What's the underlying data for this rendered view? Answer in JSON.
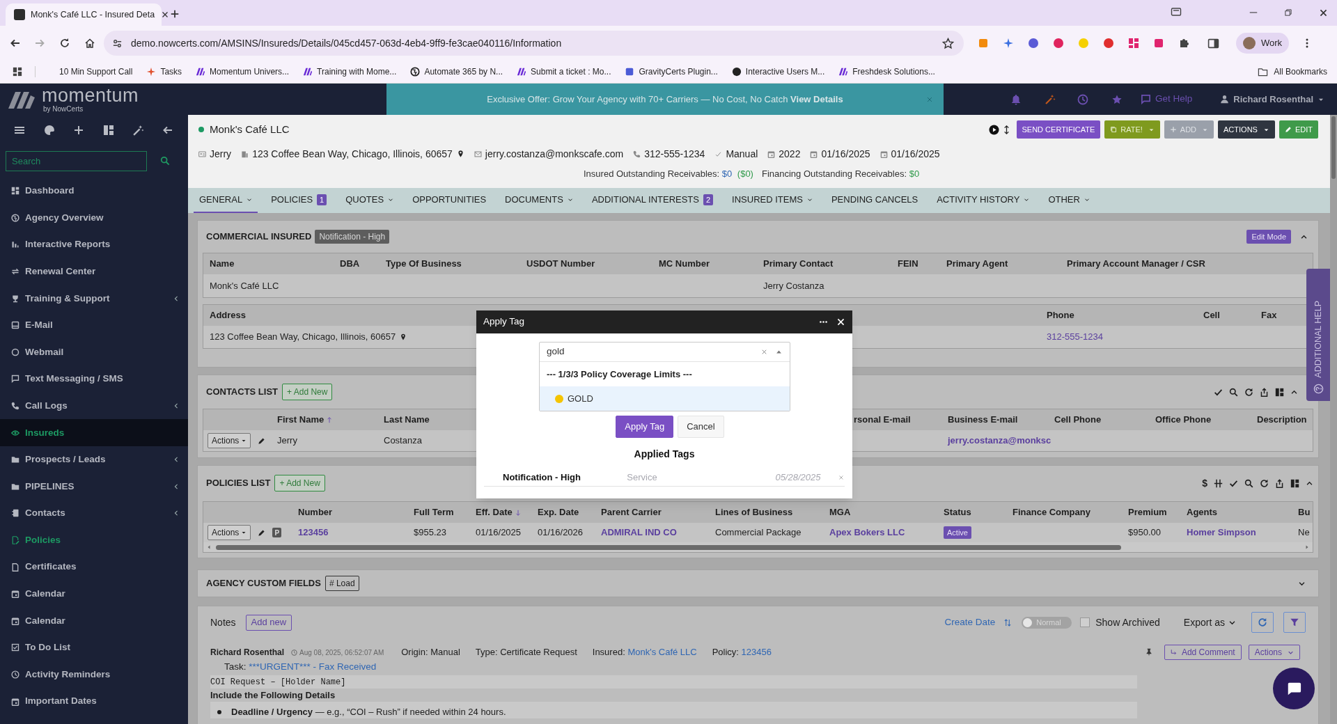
{
  "browser": {
    "tab_title": "Monk's Café LLC - Insured Deta",
    "url": "demo.nowcerts.com/AMSINS/Insureds/Details/045cd457-063d-4eb4-9ff9-fe3cae040116/Information",
    "profile": "Work",
    "bookmarks_folder": "All Bookmarks",
    "bookmarks": [
      {
        "label": "10 Min Support Call"
      },
      {
        "label": "Tasks"
      },
      {
        "label": "Momentum Univers..."
      },
      {
        "label": "Training with Mome..."
      },
      {
        "label": "Automate 365 by N..."
      },
      {
        "label": "Submit a ticket : Mo..."
      },
      {
        "label": "GravityCerts Plugin..."
      },
      {
        "label": "Interactive Users M..."
      },
      {
        "label": "Freshdesk Solutions..."
      }
    ]
  },
  "sidebar": {
    "brand": "momentum",
    "brand_sub": "by NowCerts",
    "search_placeholder": "Search",
    "items": [
      {
        "label": "Dashboard",
        "selected": false,
        "highlighted": false,
        "expandable": false
      },
      {
        "label": "Agency Overview",
        "selected": false,
        "highlighted": false,
        "expandable": false
      },
      {
        "label": "Interactive Reports",
        "selected": false,
        "highlighted": false,
        "expandable": false
      },
      {
        "label": "Renewal Center",
        "selected": false,
        "highlighted": false,
        "expandable": false
      },
      {
        "label": "Training & Support",
        "selected": false,
        "highlighted": false,
        "expandable": true
      },
      {
        "label": "E-Mail",
        "selected": false,
        "highlighted": false,
        "expandable": false
      },
      {
        "label": "Webmail",
        "selected": false,
        "highlighted": false,
        "expandable": false
      },
      {
        "label": "Text Messaging / SMS",
        "selected": false,
        "highlighted": false,
        "expandable": false
      },
      {
        "label": "Call Logs",
        "selected": false,
        "highlighted": false,
        "expandable": true
      },
      {
        "label": "Insureds",
        "selected": true,
        "highlighted": true,
        "expandable": false
      },
      {
        "label": "Prospects / Leads",
        "selected": false,
        "highlighted": false,
        "expandable": true
      },
      {
        "label": "PIPELINES",
        "selected": false,
        "highlighted": false,
        "expandable": true
      },
      {
        "label": "Contacts",
        "selected": false,
        "highlighted": false,
        "expandable": true
      },
      {
        "label": "Policies",
        "selected": false,
        "highlighted": true,
        "expandable": false
      },
      {
        "label": "Certificates",
        "selected": false,
        "highlighted": false,
        "expandable": false
      },
      {
        "label": "Calendar",
        "selected": false,
        "highlighted": false,
        "expandable": false
      },
      {
        "label": "Calendar",
        "selected": false,
        "highlighted": false,
        "expandable": false
      },
      {
        "label": "To Do List",
        "selected": false,
        "highlighted": false,
        "expandable": false
      },
      {
        "label": "Activity Reminders",
        "selected": false,
        "highlighted": false,
        "expandable": false
      },
      {
        "label": "Important Dates",
        "selected": false,
        "highlighted": false,
        "expandable": false
      }
    ]
  },
  "topbar": {
    "offer": "Exclusive Offer: Grow Your Agency with 70+ Carriers — No Cost, No Catch **View Details**",
    "help": "Get Help",
    "user": "Richard Rosenthal"
  },
  "insured": {
    "name": "Monk's Café LLC",
    "active": true,
    "actions": [
      {
        "label": "SEND CERTIFICATE",
        "kind": "send"
      },
      {
        "label": "RATE!",
        "kind": "rate"
      },
      {
        "label": "ADD",
        "kind": "add"
      },
      {
        "label": "ACTIONS",
        "kind": "actions"
      },
      {
        "label": "EDIT",
        "kind": "edit"
      }
    ],
    "info": [
      "Jerry",
      "123 Coffee Bean Way, Chicago, Illinois, 60657",
      "jerry.costanza@monkscafe.com",
      "312-555-1234",
      "Manual",
      "2022",
      "01/16/2025",
      "01/16/2025"
    ],
    "insured_receivables": {
      "label": "Insured Outstanding Receivables:",
      "amount": "$0",
      "balance": "($0)"
    },
    "financing_receivables": {
      "label": "Financing Outstanding Receivables:",
      "amount": "$0"
    }
  },
  "tabs": [
    {
      "label": "GENERAL",
      "selected": true,
      "dropdown": true
    },
    {
      "label": "POLICIES",
      "selected": false,
      "dropdown": false,
      "count": "1"
    },
    {
      "label": "QUOTES",
      "selected": false,
      "dropdown": true
    },
    {
      "label": "OPPORTUNITIES",
      "selected": false,
      "dropdown": false
    },
    {
      "label": "DOCUMENTS",
      "selected": false,
      "dropdown": true
    },
    {
      "label": "ADDITIONAL INTERESTS",
      "selected": false,
      "dropdown": false,
      "count": "2"
    },
    {
      "label": "INSURED ITEMS",
      "selected": false,
      "dropdown": true
    },
    {
      "label": "PENDING CANCELS",
      "selected": false,
      "dropdown": false
    },
    {
      "label": "ACTIVITY HISTORY",
      "selected": false,
      "dropdown": true
    },
    {
      "label": "OTHER",
      "selected": false,
      "dropdown": true
    }
  ],
  "commercial": {
    "title": "COMMERCIAL INSURED",
    "tag": "Notification - High",
    "edit_button": "Edit Mode",
    "columns": [
      "Name",
      "DBA",
      "Type Of Business",
      "USDOT Number",
      "MC Number",
      "Primary Contact",
      "FEIN",
      "Primary Agent",
      "Primary Account Manager / CSR"
    ],
    "row": {
      "name": "Monk's Café LLC",
      "primary_contact": "Jerry Costanza"
    },
    "address_columns": [
      "Address",
      "Phone",
      "Cell",
      "Fax"
    ],
    "address_row": {
      "address": "123 Coffee Bean Way, Chicago, Illinois, 60657",
      "phone": "312-555-1234"
    }
  },
  "contacts": {
    "title": "CONTACTS LIST",
    "add_button": "+ Add New",
    "columns": [
      {
        "label": "First Name",
        "sorted": true,
        "descending": false
      },
      {
        "label": "Last Name",
        "sorted": false
      },
      {
        "label": "rsonal E-mail",
        "sorted": false
      },
      {
        "label": "Business E-mail",
        "sorted": false
      },
      {
        "label": "Cell Phone",
        "sorted": false
      },
      {
        "label": "Office Phone",
        "sorted": false
      },
      {
        "label": "Description",
        "sorted": false
      }
    ],
    "row": {
      "actions": "Actions",
      "first_name": "Jerry",
      "last_name": "Costanza",
      "business_email": "jerry.costanza@monksc"
    }
  },
  "policies": {
    "title": "POLICIES LIST",
    "add_button": "+ Add New",
    "currency_tool": "$",
    "columns": [
      {
        "label": "Number",
        "sorted": false
      },
      {
        "label": "Full Term",
        "sorted": false
      },
      {
        "label": "Eff. Date",
        "sorted": true,
        "descending": true
      },
      {
        "label": "Exp. Date",
        "sorted": false
      },
      {
        "label": "Parent Carrier",
        "sorted": false
      },
      {
        "label": "Lines of Business",
        "sorted": false
      },
      {
        "label": "MGA",
        "sorted": false
      },
      {
        "label": "Status",
        "sorted": false
      },
      {
        "label": "Finance Company",
        "sorted": false
      },
      {
        "label": "Premium",
        "sorted": false
      },
      {
        "label": "Agents",
        "sorted": false
      },
      {
        "label": "Bu",
        "sorted": false
      }
    ],
    "row": {
      "actions": "Actions",
      "type_badge": "P",
      "number": "123456",
      "full_term": "$955.23",
      "eff_date": "01/16/2025",
      "exp_date": "01/16/2026",
      "parent_carrier": "ADMIRAL IND CO",
      "lines_of_business": "Commercial Package",
      "mga": "Apex Bokers LLC",
      "status": "Active",
      "premium": "$950.00",
      "agents": "Homer Simpson",
      "column_12": "Ne"
    }
  },
  "custom_fields": {
    "title": "AGENCY CUSTOM FIELDS",
    "button": "# Load"
  },
  "notes": {
    "title": "Notes",
    "add_button": "Add new",
    "sort_label": "Create Date",
    "toggle": {
      "label": "Normal",
      "on": false
    },
    "show_archived": {
      "label": "Show Archived",
      "checked": false
    },
    "export": "Export as",
    "note": {
      "author": "Richard Rosenthal",
      "timestamp": "Aug 08, 2025, 06:52:07 AM",
      "fields": [
        {
          "label": "Origin:",
          "value": "Manual",
          "link": false
        },
        {
          "label": "Type:",
          "value": "Certificate Request",
          "link": false
        },
        {
          "label": "Insured:",
          "value": "Monk's Café LLC",
          "link": true
        },
        {
          "label": "Policy:",
          "value": "123456",
          "link": true
        }
      ],
      "add_comment": "Add Comment",
      "actions": "Actions",
      "task_label": "Task:",
      "task": "***URGENT*** - Fax Received",
      "code_line": "COI Request – [Holder Name]",
      "heading": "Include the Following Details",
      "bullets": [
        "**Deadline / Urgency** — e.g., “COI – Rush” if needed within 24 hours."
      ]
    }
  },
  "help_tab": "ADDITIONAL HELP",
  "modal": {
    "title": "Apply Tag",
    "search_value": "gold",
    "options": [
      {
        "kind": "group",
        "label": "--- 1/3/3 Policy Coverage Limits ---"
      },
      {
        "kind": "option",
        "label": "GOLD",
        "color": "#f5c400",
        "highlighted": true
      }
    ],
    "buttons": [
      {
        "label": "Apply Tag",
        "kind": "primary"
      },
      {
        "label": "Cancel",
        "kind": "secondary"
      }
    ],
    "applied_title": "Applied Tags",
    "applied": [
      {
        "name": "Notification - High",
        "category": "Service",
        "date": "05/28/2025"
      }
    ]
  }
}
